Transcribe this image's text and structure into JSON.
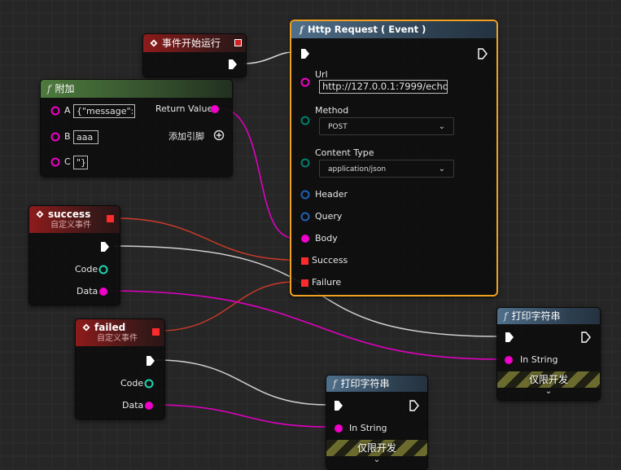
{
  "nodes": {
    "event_begin": {
      "title": "事件开始运行"
    },
    "append": {
      "title": "附加",
      "pin_a_label": "A",
      "pin_a_value": "{\"message\":\"",
      "pin_b_label": "B",
      "pin_b_value": "aaa",
      "pin_c_label": "C",
      "pin_c_value": "\"}",
      "return_label": "Return Value",
      "add_pin_label": "添加引脚"
    },
    "success_event": {
      "title": "success",
      "subtitle": "自定义事件",
      "code_label": "Code",
      "data_label": "Data"
    },
    "failed_event": {
      "title": "failed",
      "subtitle": "自定义事件",
      "code_label": "Code",
      "data_label": "Data"
    },
    "http_request": {
      "title": "Http Request ( Event )",
      "url_label": "Url",
      "url_value": "http://127.0.0.1:7999/echo",
      "method_label": "Method",
      "method_value": "POST",
      "content_type_label": "Content Type",
      "content_type_value": "application/json",
      "header_label": "Header",
      "query_label": "Query",
      "body_label": "Body",
      "success_label": "Success",
      "failure_label": "Failure"
    },
    "print_string_1": {
      "title": "打印字符串",
      "in_string_label": "In String",
      "dev_only_label": "仅限开发"
    },
    "print_string_2": {
      "title": "打印字符串",
      "in_string_label": "In String",
      "dev_only_label": "仅限开发"
    }
  },
  "icons": {
    "function": "function-icon",
    "event": "event-diamond-icon",
    "exec_pin": "exec-pin-icon",
    "string_pin": "string-pin-icon",
    "delegate_pin": "delegate-pin-icon",
    "struct_pin": "struct-pin-icon",
    "enum_pin": "enum-pin-icon",
    "add_pin": "add-pin-icon",
    "chevron": "chevron-down-icon"
  },
  "colors": {
    "background": "#262626",
    "string_pin": "#f000c8",
    "exec_pin": "#ffffff",
    "delegate_pin": "#ff3030",
    "struct_pin": "#1e5fb4",
    "int_pin": "#1ed6b0",
    "enum_pin": "#00806a",
    "selection": "#f0a020"
  }
}
